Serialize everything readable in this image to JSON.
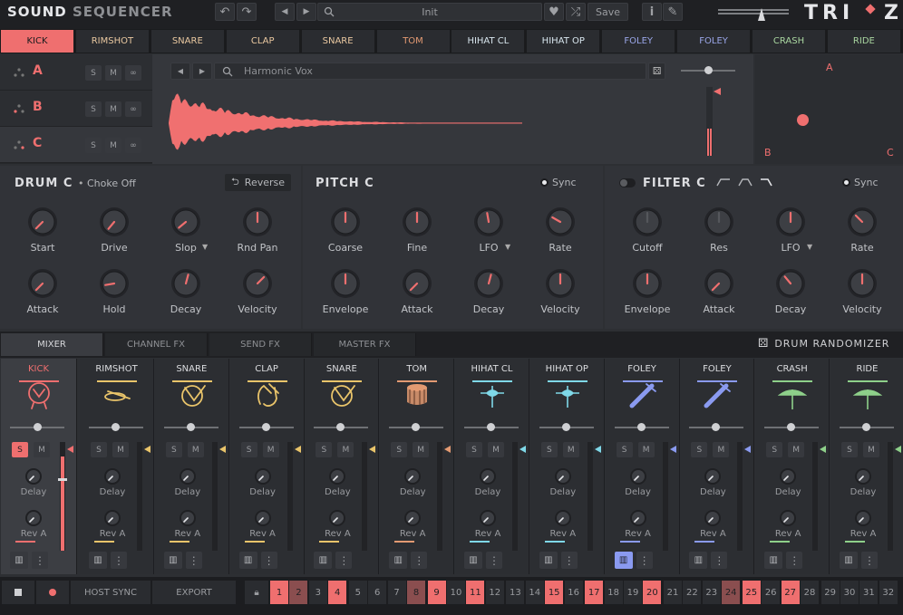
{
  "app": {
    "logo_part1": "SOUND",
    "logo_part2": "SEQUENCER",
    "brand": "TRI",
    "brand_end": "Z",
    "accent": "#ef6f6f"
  },
  "toolbar": {
    "preset_name": "Init",
    "save_label": "Save"
  },
  "tabs": [
    {
      "label": "KICK",
      "color": "#1a1b1d"
    },
    {
      "label": "RIMSHOT",
      "color": "#e9c8a0"
    },
    {
      "label": "SNARE",
      "color": "#e9c8a0"
    },
    {
      "label": "CLAP",
      "color": "#e9c8a0"
    },
    {
      "label": "SNARE",
      "color": "#e9c8a0"
    },
    {
      "label": "TOM",
      "color": "#e39a72"
    },
    {
      "label": "HIHAT CL",
      "color": "#d8e6ee"
    },
    {
      "label": "HIHAT OP",
      "color": "#d8e6ee"
    },
    {
      "label": "FOLEY",
      "color": "#9aa6e8"
    },
    {
      "label": "FOLEY",
      "color": "#9aa6e8"
    },
    {
      "label": "CRASH",
      "color": "#a9d6a0"
    },
    {
      "label": "RIDE",
      "color": "#a9d6a0"
    }
  ],
  "layers": [
    {
      "name": "A",
      "solo": "S",
      "mute": "M"
    },
    {
      "name": "B",
      "solo": "S",
      "mute": "M"
    },
    {
      "name": "C",
      "solo": "S",
      "mute": "M"
    }
  ],
  "sample": {
    "name": "Harmonic Vox"
  },
  "xy_pad": {
    "a": "A",
    "b": "B",
    "c": "C"
  },
  "drum": {
    "title": "DRUM C",
    "choke": "Choke Off",
    "reverse": "Reverse",
    "knobs": [
      "Start",
      "Drive",
      "Slop",
      "Rnd Pan",
      "Attack",
      "Hold",
      "Decay",
      "Velocity"
    ]
  },
  "pitch": {
    "title": "PITCH C",
    "sync": "Sync",
    "knobs": [
      "Coarse",
      "Fine",
      "LFO",
      "Rate",
      "Envelope",
      "Attack",
      "Decay",
      "Velocity"
    ]
  },
  "filter": {
    "title": "FILTER C",
    "sync": "Sync",
    "knobs": [
      "Cutoff",
      "Res",
      "LFO",
      "Rate",
      "Envelope",
      "Attack",
      "Decay",
      "Velocity"
    ]
  },
  "mixer_tabs": [
    "MIXER",
    "CHANNEL FX",
    "SEND FX",
    "MASTER FX"
  ],
  "randomizer": "DRUM RANDOMIZER",
  "strips": [
    {
      "name": "KICK",
      "color": "#ef6f6f",
      "icon": "kick-drum-icon"
    },
    {
      "name": "RIMSHOT",
      "color": "#e9c46a",
      "icon": "rimshot-icon"
    },
    {
      "name": "SNARE",
      "color": "#e9c46a",
      "icon": "snare-icon"
    },
    {
      "name": "CLAP",
      "color": "#e9c46a",
      "icon": "clap-icon"
    },
    {
      "name": "SNARE",
      "color": "#e9c46a",
      "icon": "snare-icon"
    },
    {
      "name": "TOM",
      "color": "#e39a72",
      "icon": "tom-icon"
    },
    {
      "name": "HIHAT CL",
      "color": "#7fd8e8",
      "icon": "hihat-icon"
    },
    {
      "name": "HIHAT OP",
      "color": "#7fd8e8",
      "icon": "hihat-icon"
    },
    {
      "name": "FOLEY",
      "color": "#8a9af0",
      "icon": "foley-icon"
    },
    {
      "name": "FOLEY",
      "color": "#8a9af0",
      "icon": "foley-icon"
    },
    {
      "name": "CRASH",
      "color": "#8ed08a",
      "icon": "cymbal-icon"
    },
    {
      "name": "RIDE",
      "color": "#8ed08a",
      "icon": "cymbal-icon"
    }
  ],
  "strip_labels": {
    "solo": "S",
    "mute": "M",
    "delay": "Delay",
    "rev": "Rev A"
  },
  "bottom": {
    "host_sync": "HOST SYNC",
    "export": "EXPORT"
  },
  "steps": [
    {
      "n": "1",
      "state": "on"
    },
    {
      "n": "2",
      "state": "dim"
    },
    {
      "n": "3",
      "state": "off"
    },
    {
      "n": "4",
      "state": "on"
    },
    {
      "n": "5",
      "state": "off"
    },
    {
      "n": "6",
      "state": "off"
    },
    {
      "n": "7",
      "state": "off"
    },
    {
      "n": "8",
      "state": "dim"
    },
    {
      "n": "9",
      "state": "on"
    },
    {
      "n": "10",
      "state": "off"
    },
    {
      "n": "11",
      "state": "on"
    },
    {
      "n": "12",
      "state": "off"
    },
    {
      "n": "13",
      "state": "off"
    },
    {
      "n": "14",
      "state": "off"
    },
    {
      "n": "15",
      "state": "on"
    },
    {
      "n": "16",
      "state": "off"
    },
    {
      "n": "17",
      "state": "on"
    },
    {
      "n": "18",
      "state": "off"
    },
    {
      "n": "19",
      "state": "off"
    },
    {
      "n": "20",
      "state": "on"
    },
    {
      "n": "21",
      "state": "off"
    },
    {
      "n": "22",
      "state": "off"
    },
    {
      "n": "23",
      "state": "off"
    },
    {
      "n": "24",
      "state": "dim"
    },
    {
      "n": "25",
      "state": "on"
    },
    {
      "n": "26",
      "state": "off"
    },
    {
      "n": "27",
      "state": "on"
    },
    {
      "n": "28",
      "state": "off"
    },
    {
      "n": "29",
      "state": "off"
    },
    {
      "n": "30",
      "state": "off"
    },
    {
      "n": "31",
      "state": "off"
    },
    {
      "n": "32",
      "state": "off"
    }
  ]
}
